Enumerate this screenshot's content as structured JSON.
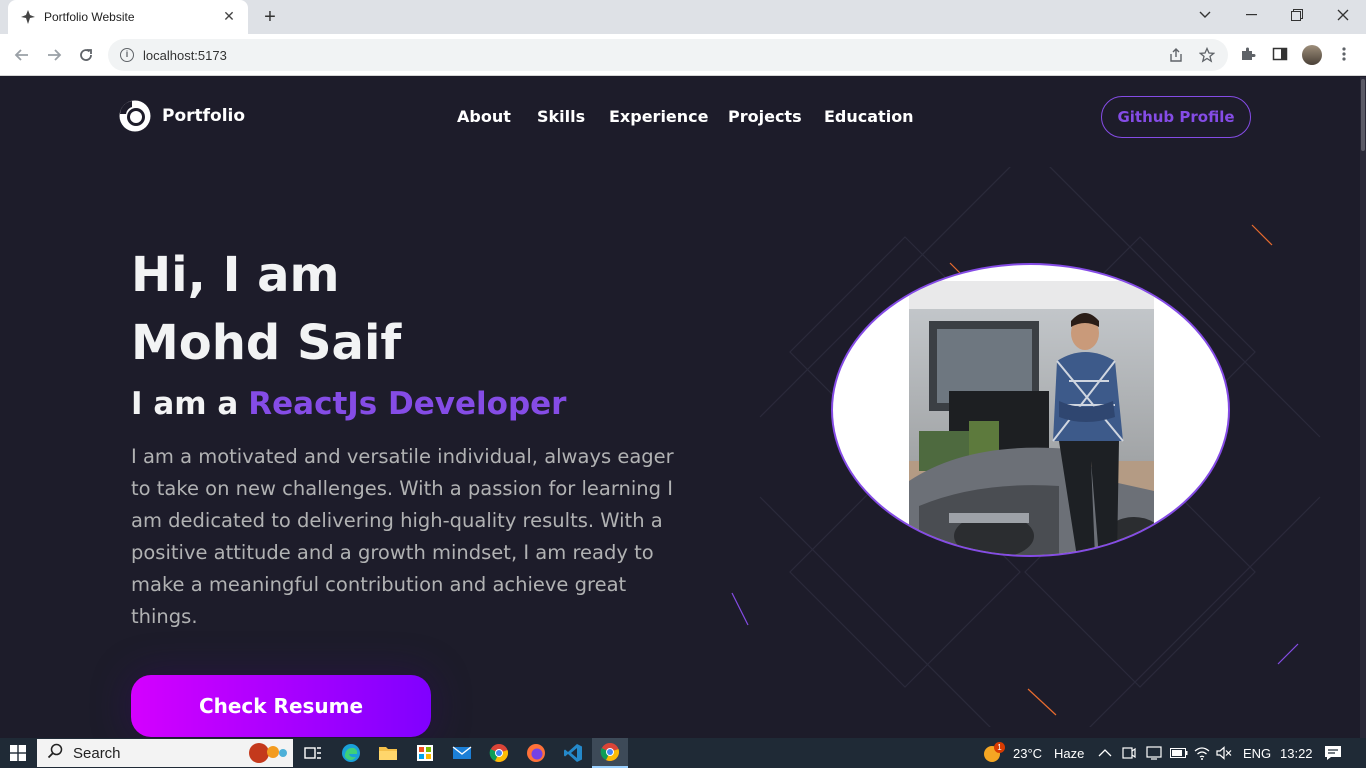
{
  "browser": {
    "tab_title": "Portfolio Website",
    "url": "localhost:5173"
  },
  "site": {
    "logo_text": "Portfolio",
    "nav": [
      "About",
      "Skills",
      "Experience",
      "Projects",
      "Education"
    ],
    "github_button": "Github Profile"
  },
  "hero": {
    "greeting_line1": "Hi, I am",
    "greeting_line2": "Mohd Saif",
    "role_prefix": "I am a",
    "role": "ReactJs Developer",
    "description": "I am a motivated and versatile individual, always eager to take on new challenges. With a passion for learning I am dedicated to delivering high-quality results. With a positive attitude and a growth mindset, I am ready to make a meaningful contribution and achieve great things.",
    "resume_button": "Check Resume"
  },
  "colors": {
    "accent": "#854ce6",
    "background": "#1d1c2a",
    "button_gradient_start": "#d400ff",
    "button_gradient_end": "#8000ff"
  },
  "taskbar": {
    "search_label": "Search",
    "weather_temp": "23°C",
    "weather_desc": "Haze",
    "weather_badge": "1",
    "language": "ENG",
    "time": "13:22"
  }
}
